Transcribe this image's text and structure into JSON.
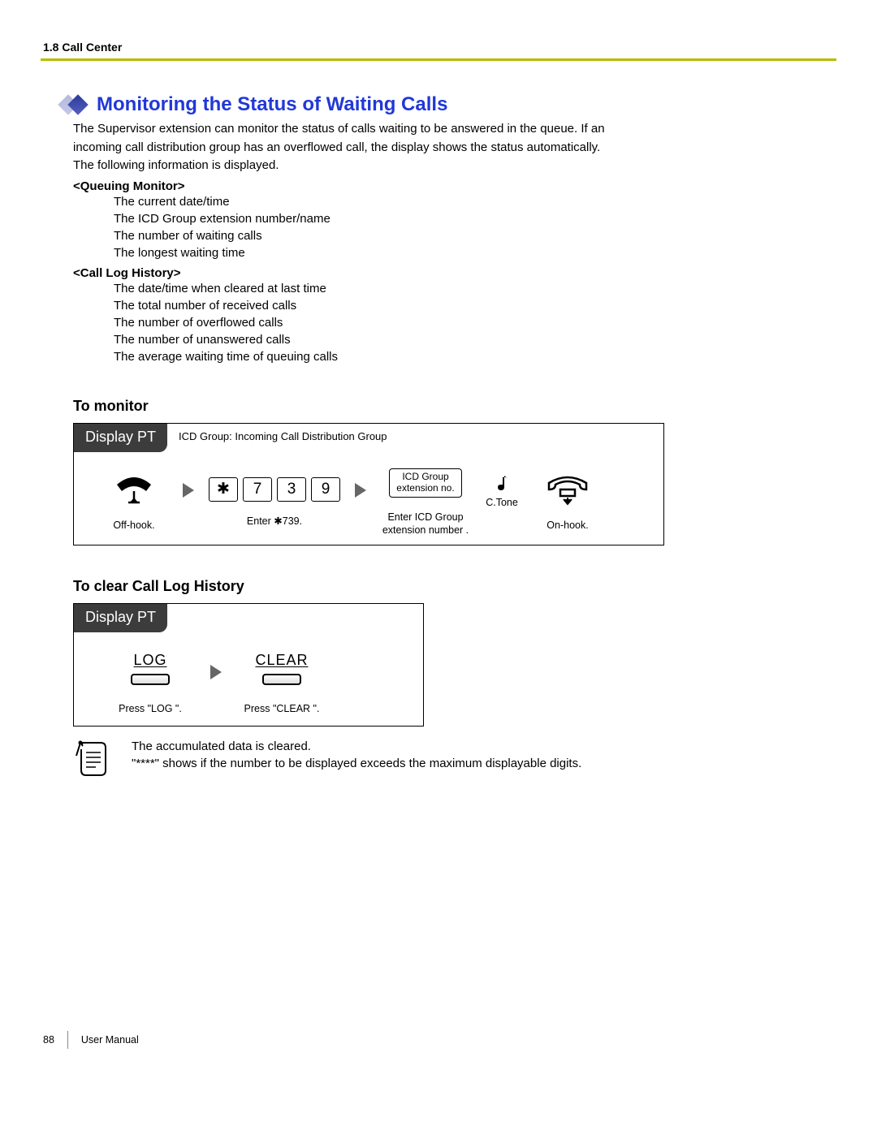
{
  "header": {
    "section": "1.8 Call Center"
  },
  "title": "Monitoring the Status of Waiting Calls",
  "intro": [
    "The Supervisor extension can monitor the status of calls waiting to be answered in the queue. If an",
    "incoming call distribution group has an overflowed call, the display shows the status automatically.",
    "The following information is displayed."
  ],
  "queuing": {
    "label": "<Queuing Monitor>",
    "items": [
      "The current date/time",
      "The ICD Group extension number/name",
      "The number of waiting calls",
      "The longest waiting time"
    ]
  },
  "callLog": {
    "label": "<Call Log History>",
    "items": [
      "The date/time when cleared at last time",
      "The total number of received calls",
      "The number of overflowed calls",
      "The number of unanswered calls",
      "The average waiting time of queuing calls"
    ]
  },
  "toMonitor": {
    "heading": "To monitor",
    "badge": "Display PT",
    "note": "ICD Group: Incoming Call Distribution Group",
    "offhook": "Off-hook.",
    "keys": [
      "✱",
      "7",
      "3",
      "9"
    ],
    "enter": "Enter  ✱739.",
    "ext1": "ICD Group",
    "ext2": "extension no.",
    "extCap1": "Enter ICD Group",
    "extCap2": "extension number  .",
    "ctone": "C.Tone",
    "onhook": "On-hook."
  },
  "toClear": {
    "heading": "To clear Call Log History",
    "badge": "Display PT",
    "log": "LOG",
    "logCap": "Press \"LOG \".",
    "clear": "CLEAR",
    "clearCap": "Press \"CLEAR \"."
  },
  "notes": [
    "The accumulated data is cleared.",
    "\"****\" shows if the number to be displayed exceeds the maximum displayable digits."
  ],
  "footer": {
    "page": "88",
    "label": "User Manual"
  }
}
